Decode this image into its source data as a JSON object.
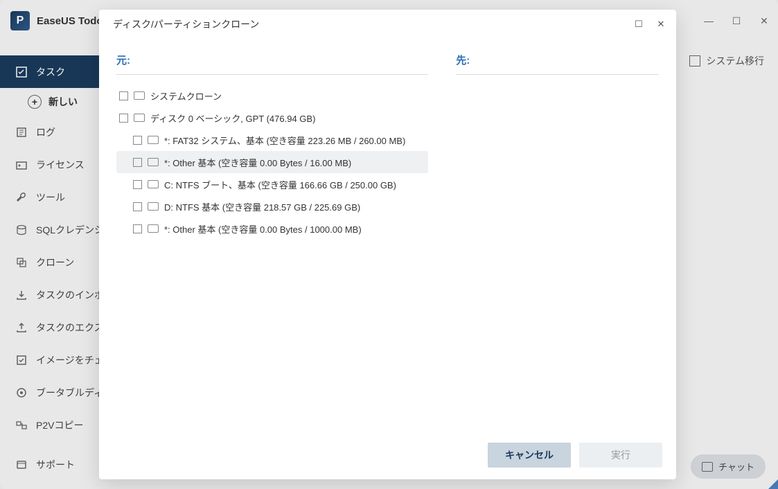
{
  "app": {
    "title": "EaseUS Todo"
  },
  "sidebar": {
    "items": [
      {
        "label": "タスク",
        "icon": "task"
      },
      {
        "label": "ログ",
        "icon": "log"
      },
      {
        "label": "ライセンス",
        "icon": "license"
      },
      {
        "label": "ツール",
        "icon": "tools"
      },
      {
        "label": "SQLクレデンシャ",
        "icon": "sql"
      },
      {
        "label": "クローン",
        "icon": "clone"
      },
      {
        "label": "タスクのインポート",
        "icon": "import"
      },
      {
        "label": "タスクのエクスポ",
        "icon": "export"
      },
      {
        "label": "イメージをチェッ",
        "icon": "check"
      },
      {
        "label": "ブータブルディス",
        "icon": "bootable"
      },
      {
        "label": "P2Vコピー",
        "icon": "p2v"
      },
      {
        "label": "サポート",
        "icon": "support"
      }
    ],
    "new_button": "新しい"
  },
  "top_action": {
    "label": "システム移行"
  },
  "modal": {
    "title": "ディスク/パーティションクローン",
    "source_label": "元:",
    "dest_label": "先:",
    "tree": [
      {
        "level": 0,
        "label": "システムクローン"
      },
      {
        "level": 0,
        "label": "ディスク 0 ベーシック, GPT (476.94 GB)"
      },
      {
        "level": 2,
        "label": "*: FAT32 システム、基本 (空き容量 223.26 MB / 260.00 MB)"
      },
      {
        "level": 2,
        "label": "*: Other 基本 (空き容量 0.00 Bytes / 16.00 MB)",
        "hover": true
      },
      {
        "level": 2,
        "label": "C: NTFS ブート、基本 (空き容量 166.66 GB / 250.00 GB)"
      },
      {
        "level": 2,
        "label": "D: NTFS 基本 (空き容量 218.57 GB / 225.69 GB)"
      },
      {
        "level": 2,
        "label": "*: Other 基本 (空き容量 0.00 Bytes / 1000.00 MB)"
      }
    ],
    "cancel": "キャンセル",
    "execute": "実行"
  },
  "chat": {
    "label": "チャット"
  }
}
